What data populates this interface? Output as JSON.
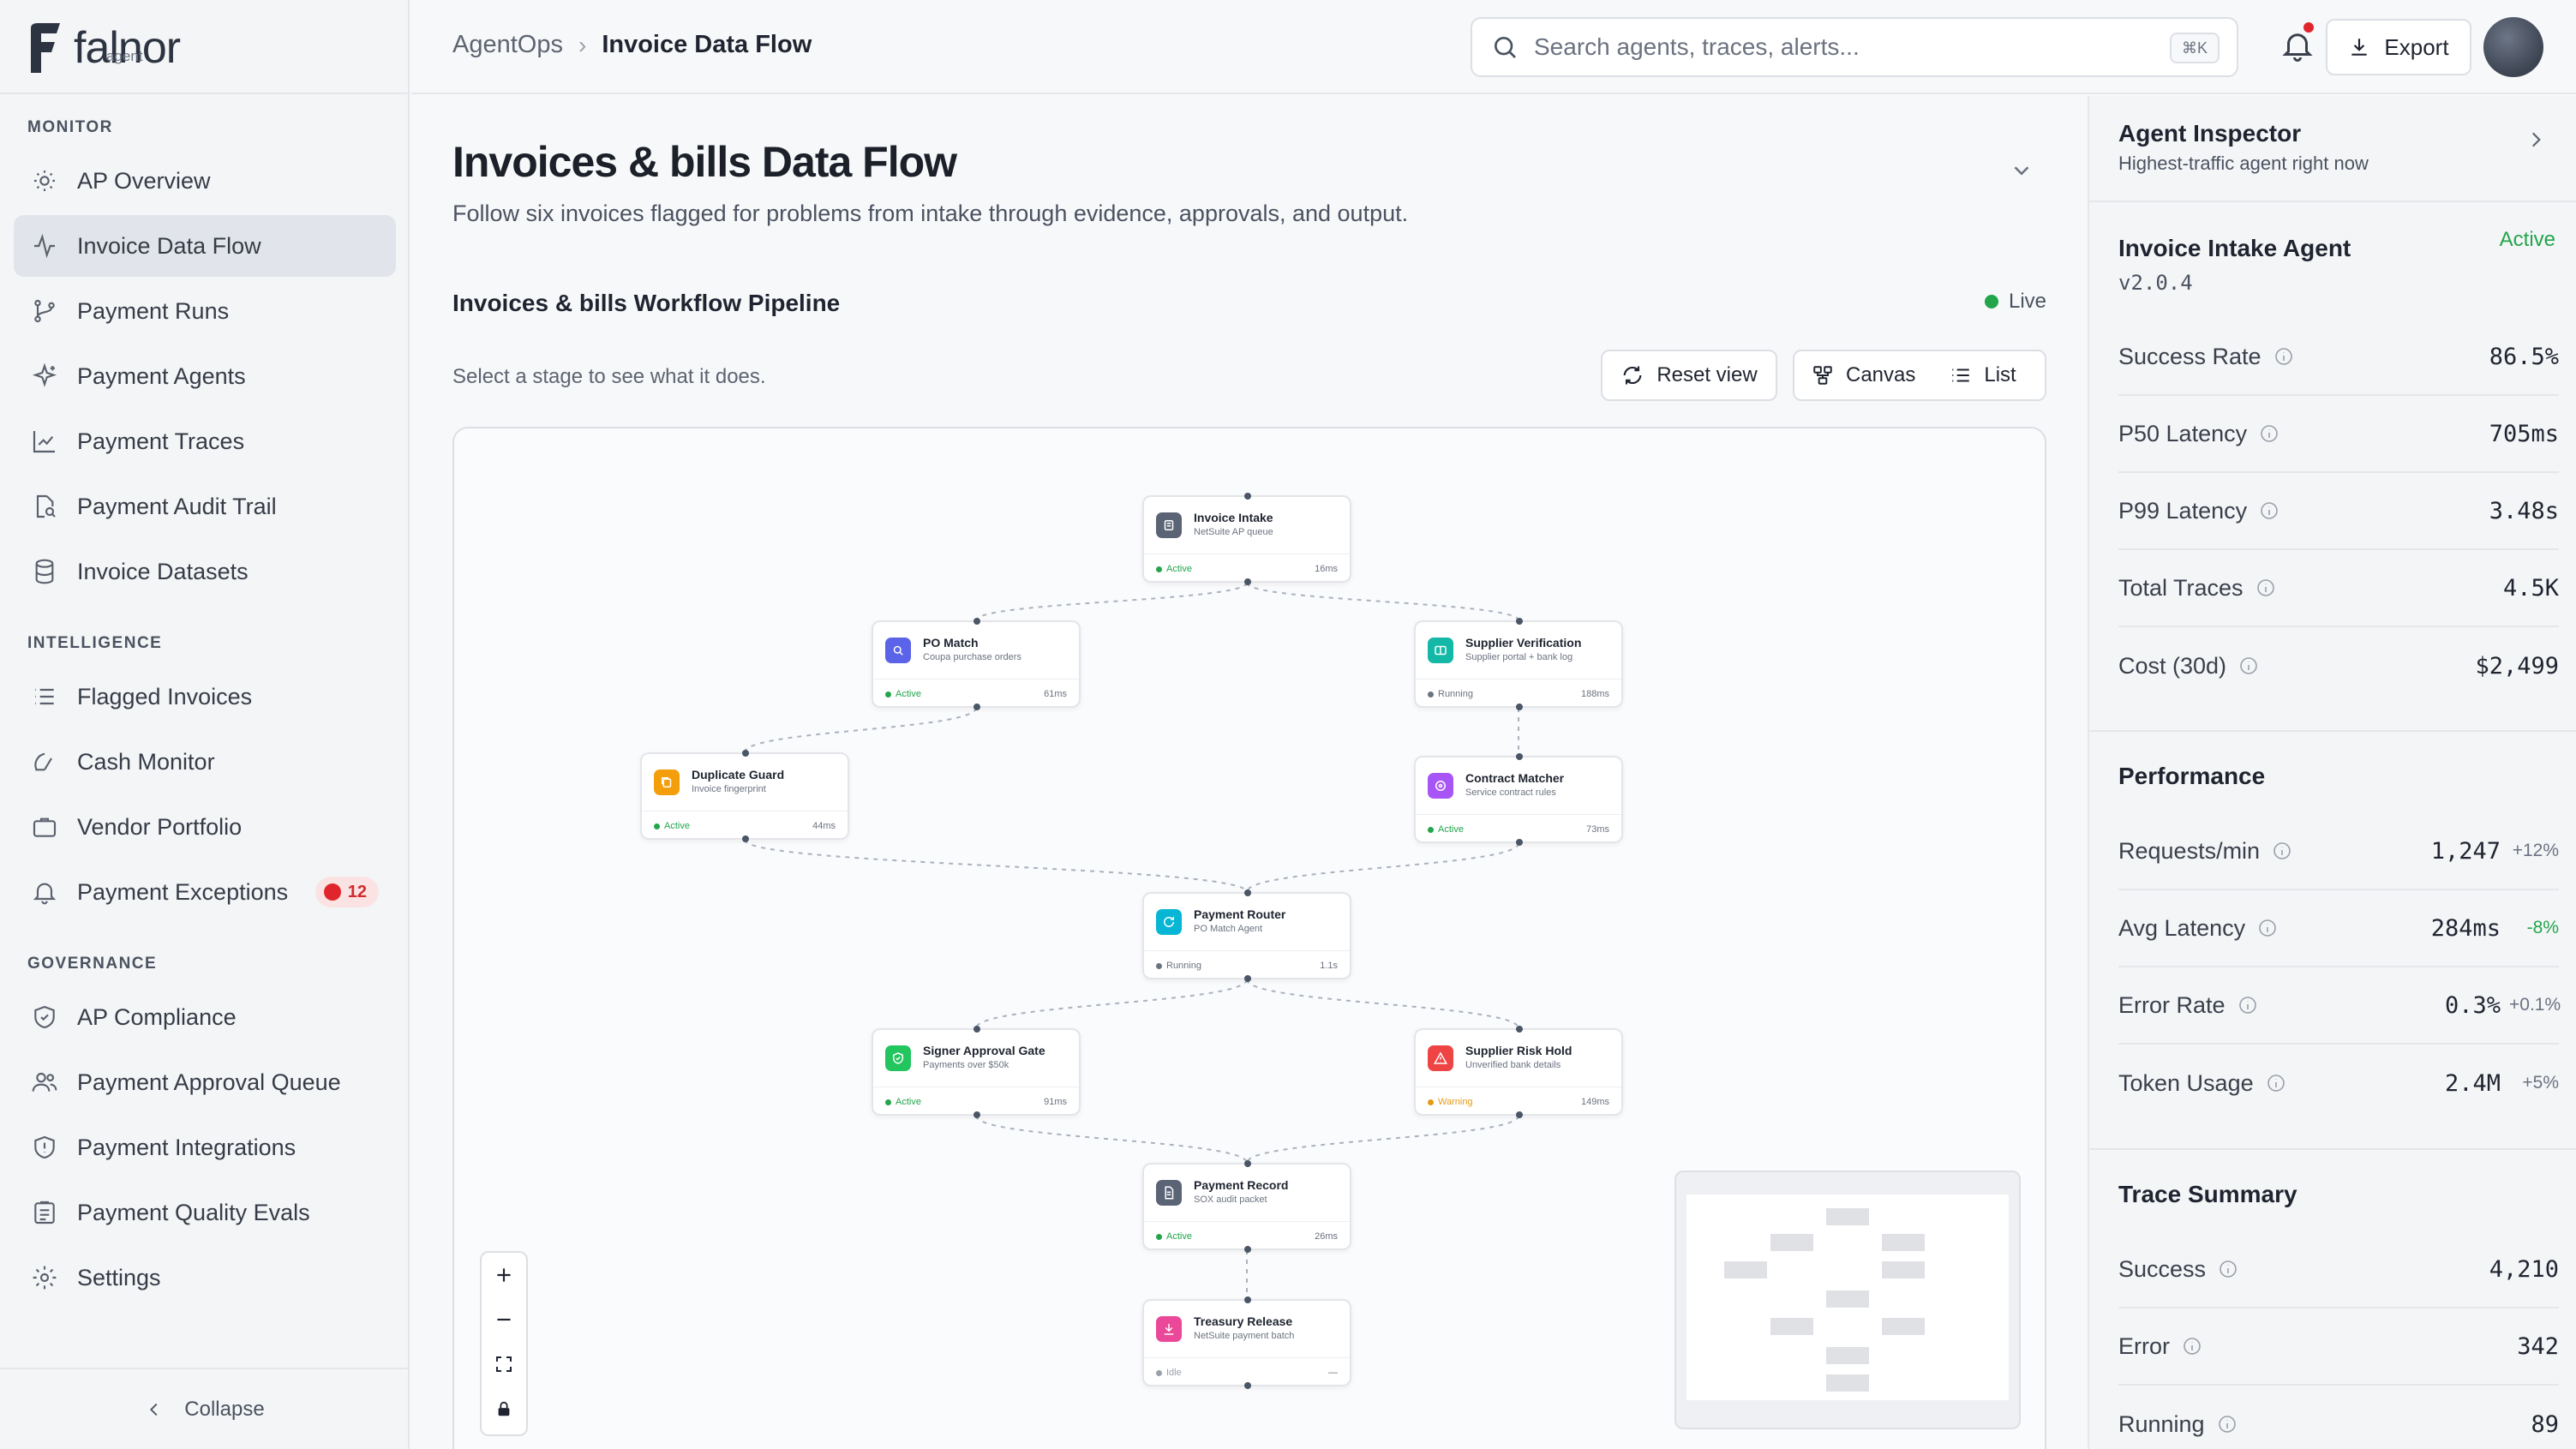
{
  "brand": {
    "name": "falnor",
    "sub": "agent"
  },
  "sidebar": {
    "sections": [
      {
        "label": "MONITOR",
        "items": [
          {
            "label": "AP Overview",
            "icon": "sun-icon"
          },
          {
            "label": "Invoice Data Flow",
            "icon": "activity-icon",
            "active": true
          },
          {
            "label": "Payment Runs",
            "icon": "git-branch-icon"
          },
          {
            "label": "Payment Agents",
            "icon": "sparkles-icon"
          },
          {
            "label": "Payment Traces",
            "icon": "line-chart-icon"
          },
          {
            "label": "Payment Audit Trail",
            "icon": "file-search-icon"
          },
          {
            "label": "Invoice Datasets",
            "icon": "database-icon"
          }
        ]
      },
      {
        "label": "INTELLIGENCE",
        "items": [
          {
            "label": "Flagged Invoices",
            "icon": "list-icon"
          },
          {
            "label": "Cash Monitor",
            "icon": "radar-icon"
          },
          {
            "label": "Vendor Portfolio",
            "icon": "briefcase-icon"
          },
          {
            "label": "Payment Exceptions",
            "icon": "bell-icon",
            "badge": "12"
          }
        ]
      },
      {
        "label": "GOVERNANCE",
        "items": [
          {
            "label": "AP Compliance",
            "icon": "shield-check-icon"
          },
          {
            "label": "Payment Approval Queue",
            "icon": "users-icon"
          },
          {
            "label": "Payment Integrations",
            "icon": "shield-icon"
          },
          {
            "label": "Payment Quality Evals",
            "icon": "clipboard-icon"
          },
          {
            "label": "Settings",
            "icon": "gear-icon"
          }
        ]
      }
    ],
    "collapse_label": "Collapse"
  },
  "topbar": {
    "breadcrumb": [
      "AgentOps",
      "Invoice Data Flow"
    ],
    "search_placeholder": "Search agents, traces, alerts...",
    "search_shortcut": "⌘K",
    "export_label": "Export"
  },
  "main": {
    "title": "Invoices & bills Data Flow",
    "subtitle": "Follow six invoices flagged for problems from intake through evidence, approvals, and output.",
    "pipeline_title": "Invoices & bills Workflow Pipeline",
    "live_label": "Live",
    "hint": "Select a stage to see what it does.",
    "reset_label": "Reset view",
    "canvas_label": "Canvas",
    "list_label": "List"
  },
  "colors": {
    "active": "#22a54b",
    "running": "#6b7280",
    "warning": "#e59a16",
    "idle": "#9aa0aa",
    "badge_red": "#e0262c"
  },
  "nodes": [
    {
      "title": "Invoice Intake",
      "sub": "NetSuite AP queue",
      "status": "Active",
      "time": "16ms",
      "color": "#5b6475",
      "icon": "box-icon"
    },
    {
      "title": "PO Match",
      "sub": "Coupa purchase orders",
      "status": "Active",
      "time": "61ms",
      "color": "#5b63e8",
      "icon": "search-icon"
    },
    {
      "title": "Supplier Verification",
      "sub": "Supplier portal + bank log",
      "status": "Running",
      "time": "188ms",
      "color": "#14b8a6",
      "icon": "columns-icon"
    },
    {
      "title": "Duplicate Guard",
      "sub": "Invoice fingerprint",
      "status": "Active",
      "time": "44ms",
      "color": "#f59e0b",
      "icon": "copy-icon"
    },
    {
      "title": "Contract Matcher",
      "sub": "Service contract rules",
      "status": "Active",
      "time": "73ms",
      "color": "#a855f7",
      "icon": "target-icon"
    },
    {
      "title": "Payment Router",
      "sub": "PO Match Agent",
      "status": "Running",
      "time": "1.1s",
      "color": "#06b6d4",
      "icon": "refresh-icon"
    },
    {
      "title": "Signer Approval Gate",
      "sub": "Payments over $50k",
      "status": "Active",
      "time": "91ms",
      "color": "#22c55e",
      "icon": "shield-icon"
    },
    {
      "title": "Supplier Risk Hold",
      "sub": "Unverified bank details",
      "status": "Warning",
      "time": "149ms",
      "color": "#ef4444",
      "icon": "alert-icon"
    },
    {
      "title": "Payment Record",
      "sub": "SOX audit packet",
      "status": "Active",
      "time": "26ms",
      "color": "#5b6475",
      "icon": "doc-icon"
    },
    {
      "title": "Treasury Release",
      "sub": "NetSuite payment batch",
      "status": "Idle",
      "time": "—",
      "color": "#ec4899",
      "icon": "download-icon"
    }
  ],
  "inspector": {
    "title": "Agent Inspector",
    "subtitle": "Highest-traffic agent right now",
    "agent_name": "Invoice Intake Agent",
    "agent_version": "v2.0.4",
    "agent_status": "Active",
    "metrics": [
      {
        "label": "Success Rate",
        "value": "86.5%"
      },
      {
        "label": "P50 Latency",
        "value": "705ms"
      },
      {
        "label": "P99 Latency",
        "value": "3.48s"
      },
      {
        "label": "Total Traces",
        "value": "4.5K"
      },
      {
        "label": "Cost (30d)",
        "value": "$2,499"
      }
    ],
    "performance_title": "Performance",
    "performance": [
      {
        "label": "Requests/min",
        "value": "1,247",
        "delta": "+12%",
        "delta_color": "#6b7280"
      },
      {
        "label": "Avg Latency",
        "value": "284ms",
        "delta": "-8%",
        "delta_color": "#22a54b"
      },
      {
        "label": "Error Rate",
        "value": "0.3%",
        "delta": "+0.1%",
        "delta_color": "#6b7280"
      },
      {
        "label": "Token Usage",
        "value": "2.4M",
        "delta": "+5%",
        "delta_color": "#6b7280"
      }
    ],
    "trace_title": "Trace Summary",
    "trace": [
      {
        "label": "Success",
        "value": "4,210"
      },
      {
        "label": "Error",
        "value": "342"
      },
      {
        "label": "Running",
        "value": "89"
      }
    ]
  }
}
